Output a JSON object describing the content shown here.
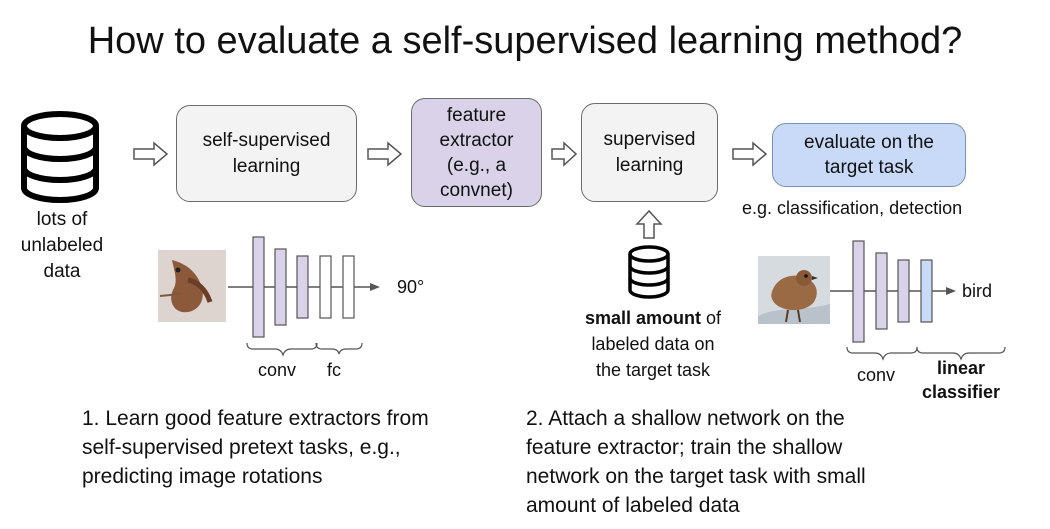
{
  "title": "How to evaluate a self-supervised learning method?",
  "data_source": {
    "label_lines": [
      "lots of",
      "unlabeled",
      "data"
    ],
    "icon": "database-icon"
  },
  "boxes": {
    "ssl": [
      "self-supervised",
      "learning"
    ],
    "feature": [
      "feature",
      "extractor",
      "(e.g., a",
      "convnet)"
    ],
    "supervised": [
      "supervised",
      "learning"
    ],
    "evaluate": [
      "evaluate on the",
      "target task"
    ]
  },
  "eval_examples": "e.g. classification, detection",
  "labeled_data": {
    "bold": "small amount",
    "rest_first": " of",
    "lines": [
      "labeled data on",
      "the target task"
    ],
    "icon": "database-icon"
  },
  "pretext_network": {
    "output": "90°",
    "labels": {
      "conv": "conv",
      "fc": "fc"
    }
  },
  "target_network": {
    "output": "bird",
    "labels": {
      "conv": "conv",
      "linear_1": "linear",
      "linear_2": "classifier"
    }
  },
  "steps": {
    "one": [
      "1. Learn good feature extractors from",
      "self-supervised pretext tasks, e.g.,",
      "predicting image rotations"
    ],
    "two": [
      "2. Attach a shallow network on the",
      "feature extractor; train the shallow",
      "network on the target task with small",
      "amount of labeled data"
    ]
  },
  "colors": {
    "box_gray": "#f3f3f3",
    "box_purple": "#d9d2e9",
    "box_blue": "#c9daf8",
    "layer_purple": "#d9d2e9",
    "layer_blue": "#c9daf8"
  }
}
